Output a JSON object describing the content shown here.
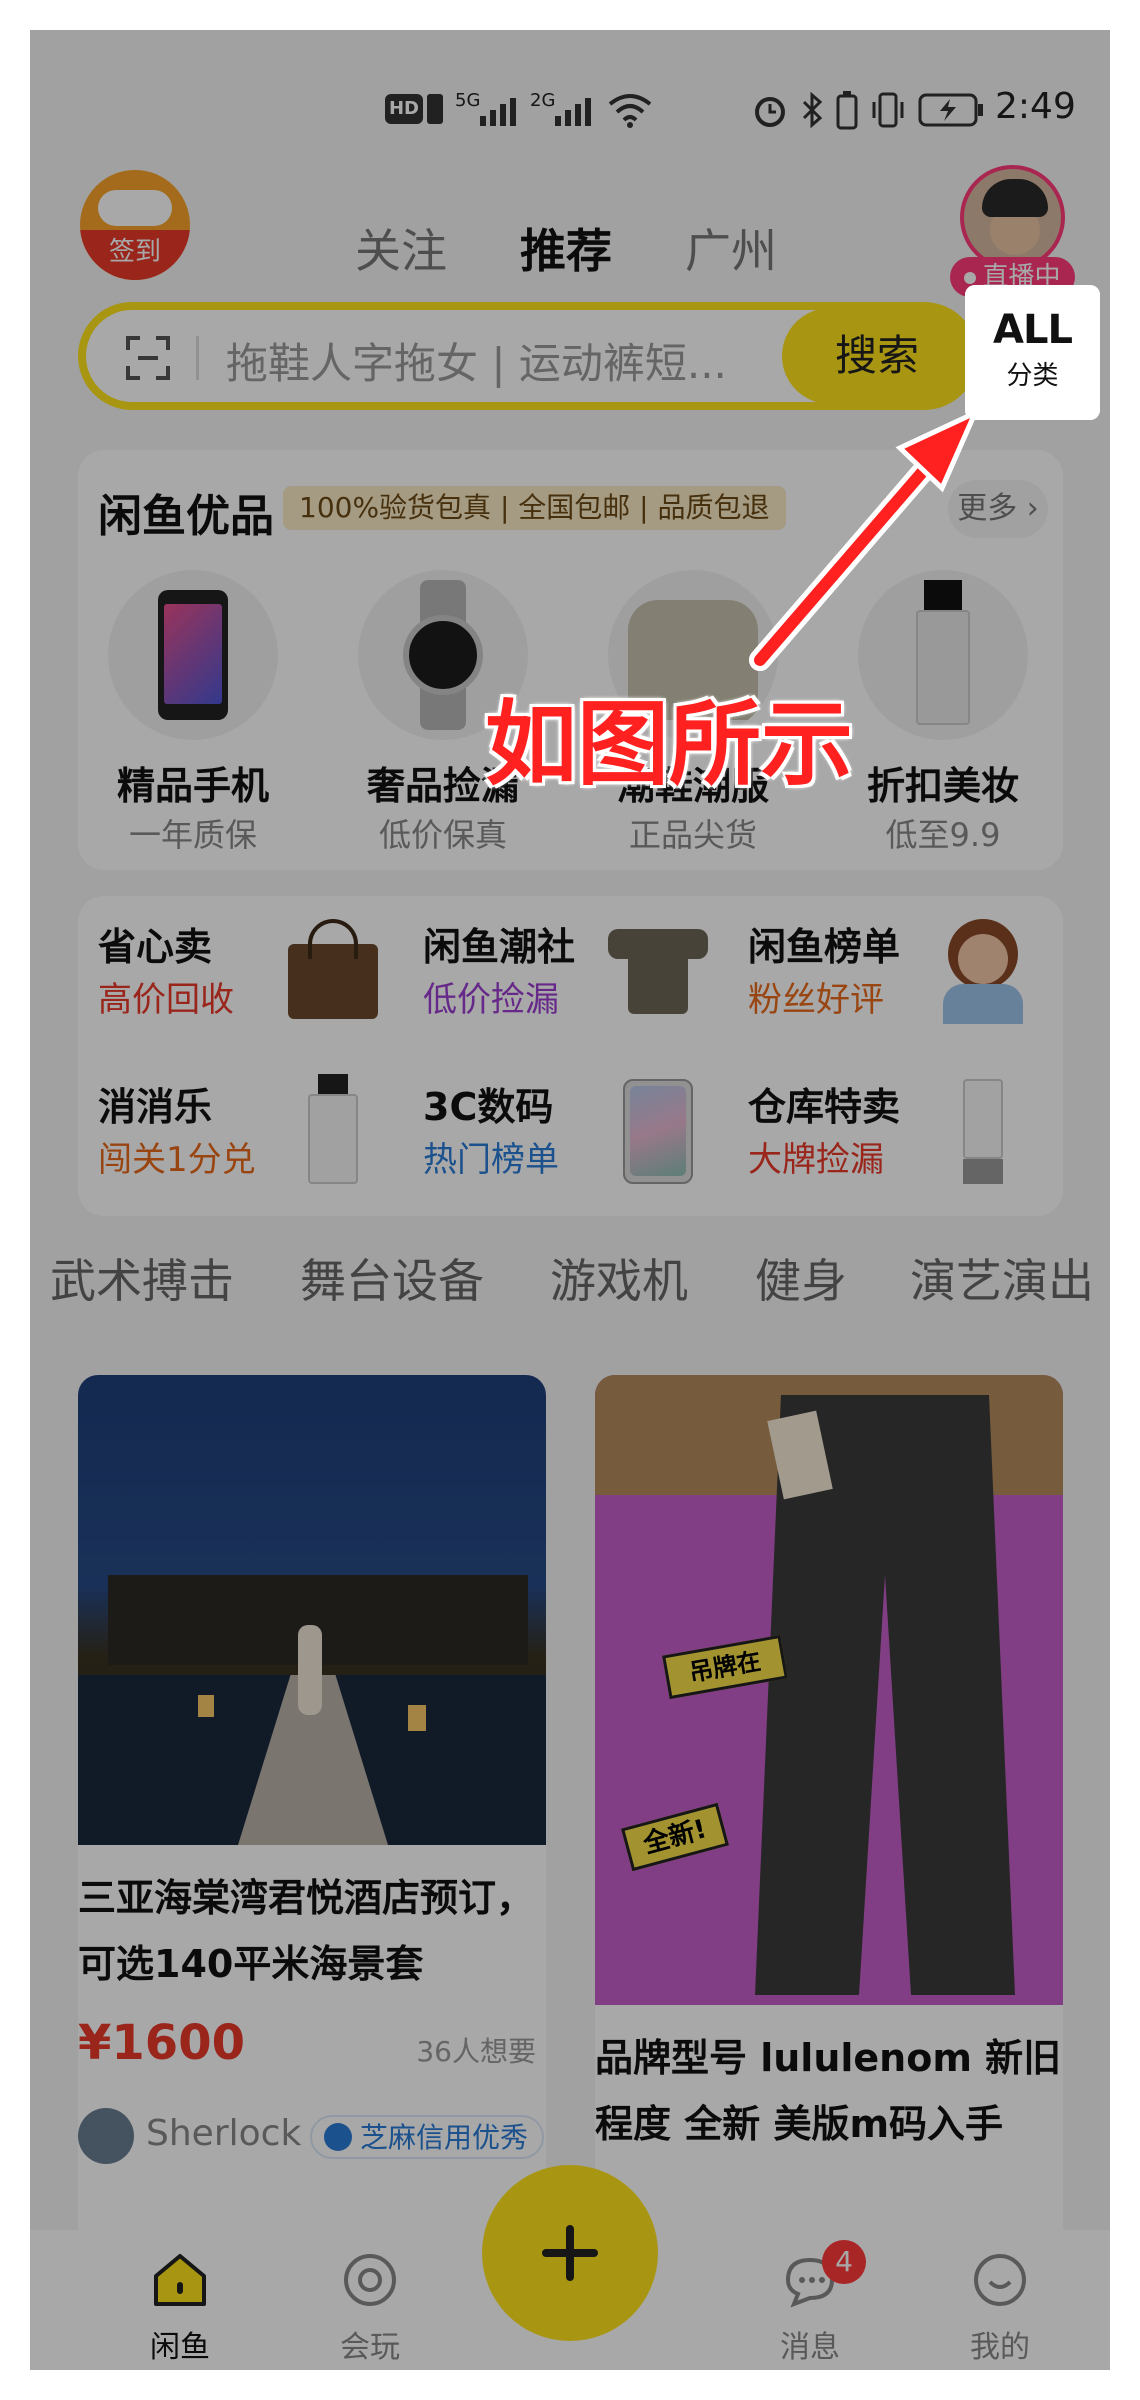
{
  "status_bar": {
    "network_badge": "HD",
    "net_5g": "5G",
    "net_2g": "2G",
    "time": "2:49"
  },
  "header": {
    "checkin_label": "签到",
    "tabs": [
      {
        "label": "关注"
      },
      {
        "label": "推荐"
      },
      {
        "label": "广州"
      }
    ],
    "live_label": "直播中"
  },
  "search": {
    "placeholder": "拖鞋人字拖女 | 运动裤短...",
    "button_label": "搜索"
  },
  "all_category": {
    "big": "ALL",
    "small": "分类"
  },
  "youpin": {
    "title": "闲鱼优品",
    "badge": "100%验货包真 | 全国包邮 | 品质包退",
    "more_label": "更多",
    "items": [
      {
        "name": "精品手机",
        "sub": "一年质保"
      },
      {
        "name": "奢品捡漏",
        "sub": "低价保真"
      },
      {
        "name": "潮鞋潮服",
        "sub": "正品尖货"
      },
      {
        "name": "折扣美妆",
        "sub": "低至9.9"
      }
    ]
  },
  "services": [
    {
      "title": "省心卖",
      "sub": "高价回收",
      "color": "#e8392a"
    },
    {
      "title": "闲鱼潮社",
      "sub": "低价捡漏",
      "color": "#9b3fd0"
    },
    {
      "title": "闲鱼榜单",
      "sub": "粉丝好评",
      "color": "#e86a1a"
    },
    {
      "title": "消消乐",
      "sub": "闯关1分兑",
      "color": "#e86a1a"
    },
    {
      "title": "3C数码",
      "sub": "热门榜单",
      "color": "#2a7bd6"
    },
    {
      "title": "仓库特卖",
      "sub": "大牌捡漏",
      "color": "#e8392a"
    }
  ],
  "categories": [
    "武术搏击",
    "舞台设备",
    "游戏机",
    "健身",
    "演艺演出"
  ],
  "feed": [
    {
      "title": "三亚海棠湾君悦酒店预订，可选140平米海景套",
      "price": "¥1600",
      "wants": "36人想要",
      "seller": "Sherlock",
      "credit": "芝麻信用优秀"
    },
    {
      "title": "品牌型号 lululenom 新旧程度 全新 美版m码入手",
      "sticker1": "吊牌在",
      "sticker2": "全新!"
    }
  ],
  "tabbar": [
    {
      "label": "闲鱼"
    },
    {
      "label": "会玩"
    },
    {
      "label": "消息",
      "badge": "4"
    },
    {
      "label": "我的"
    }
  ],
  "annotation": {
    "text": "如图所示"
  },
  "colors": {
    "accent_yellow": "#ffe31a",
    "annotation_red": "#ff2020",
    "price_red": "#e8392a"
  }
}
